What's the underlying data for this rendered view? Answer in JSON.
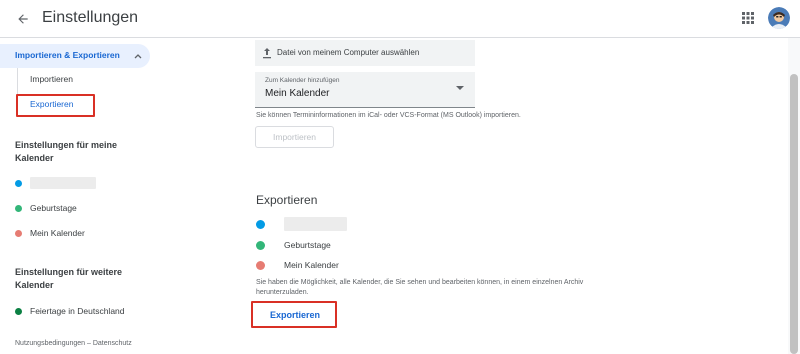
{
  "header": {
    "title": "Einstellungen",
    "back_icon": "arrow-left-icon",
    "apps_icon": "grid-apps-icon",
    "avatar_icon": "user-avatar"
  },
  "sidebar": {
    "active_section": "Importieren & Exportieren",
    "sub_items": [
      {
        "label": "Importieren"
      },
      {
        "label": "Exportieren"
      }
    ],
    "my_calendars_heading": "Einstellungen für meine Kalender",
    "my_calendars": [
      {
        "label": "",
        "color": "#039be5",
        "blurred": true
      },
      {
        "label": "Geburtstage",
        "color": "#33b679",
        "blurred": false
      },
      {
        "label": "Mein Kalender",
        "color": "#e67c73",
        "blurred": false
      }
    ],
    "other_calendars_heading": "Einstellungen für weitere Kalender",
    "other_calendars": [
      {
        "label": "Feiertage in Deutschland",
        "color": "#0b8043"
      }
    ],
    "footer": "Nutzungsbedingungen – Datenschutz"
  },
  "import": {
    "file_button": "Datei von meinem Computer auswählen",
    "select_label": "Zum Kalender hinzufügen",
    "select_value": "Mein Kalender",
    "hint": "Sie können Termininformationen im iCal- oder VCS-Format (MS Outlook) importieren.",
    "button": "Importieren"
  },
  "export": {
    "title": "Exportieren",
    "calendars": [
      {
        "label": "",
        "color": "#039be5",
        "blurred": true
      },
      {
        "label": "Geburtstage",
        "color": "#33b679",
        "blurred": false
      },
      {
        "label": "Mein Kalender",
        "color": "#e67c73",
        "blurred": false
      }
    ],
    "hint_line1": "Sie haben die Möglichkeit, alle Kalender, die Sie sehen und bearbeiten können, in einem einzelnen Archiv",
    "hint_line2": "herunterzuladen.",
    "button": "Exportieren"
  },
  "colors": {
    "accent": "#1967d2",
    "highlight": "#d93025",
    "active_bg": "#e8f0fe"
  }
}
